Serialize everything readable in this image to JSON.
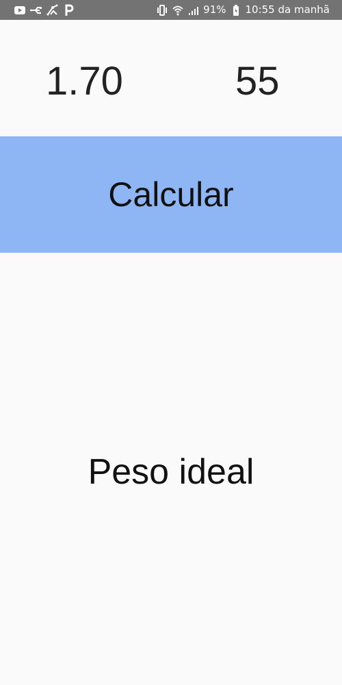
{
  "status_bar": {
    "background": "#737373",
    "left_icons": [
      "youtube-icon",
      "usb-icon",
      "network-icon",
      "parking-icon"
    ],
    "right_icons": [
      "vibrate-icon",
      "wifi-icon",
      "signal-icon",
      "battery-icon"
    ],
    "battery_percent": "91%",
    "time": "10:55 da manhã"
  },
  "main": {
    "background": "#fafafa",
    "height_value": "1.70",
    "weight_value": "55",
    "calculate_label": "Calcular",
    "button_color": "#8fb6f4",
    "result_text": "Peso ideal"
  }
}
